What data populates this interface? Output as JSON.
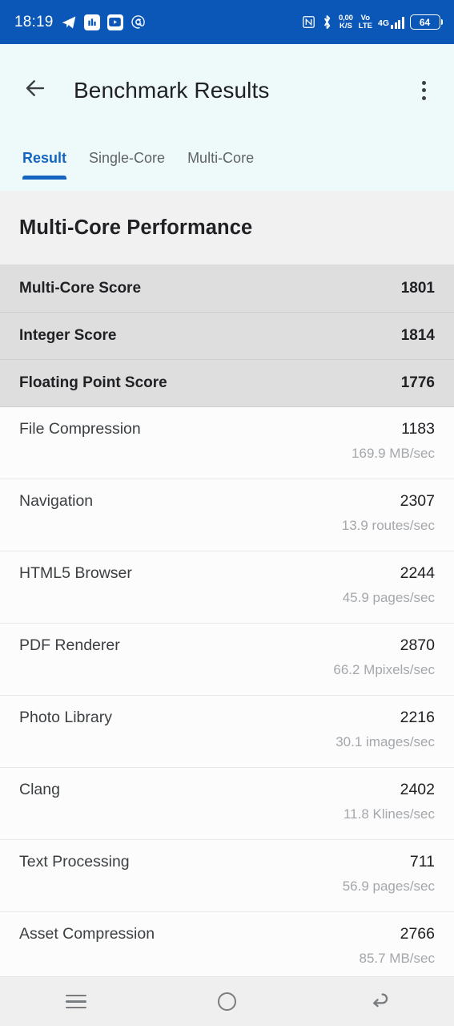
{
  "status_bar": {
    "time": "18:19",
    "left_icons": [
      "telegram-icon",
      "app-icon",
      "youtube-icon",
      "at-icon"
    ],
    "right_icons": [
      "nfc-icon",
      "bluetooth-icon"
    ],
    "data_rate_value": "0,00",
    "data_rate_unit": "K/S",
    "volte_top": "Vo",
    "volte_bottom": "LTE",
    "network_type": "4G",
    "battery_level": "64",
    "background_color": "#0b57b8"
  },
  "app_bar": {
    "back_label": "back-arrow",
    "title": "Benchmark Results",
    "overflow_label": "more-options",
    "background_color": "#eefaf9"
  },
  "tabs": {
    "accent_color": "#1565c0",
    "items": [
      {
        "label": "Result",
        "active": true
      },
      {
        "label": "Single-Core",
        "active": false
      },
      {
        "label": "Multi-Core",
        "active": false
      }
    ]
  },
  "section": {
    "heading": "Multi-Core Performance"
  },
  "summary_rows": [
    {
      "label": "Multi-Core Score",
      "value": "1801"
    },
    {
      "label": "Integer Score",
      "value": "1814"
    },
    {
      "label": "Floating Point Score",
      "value": "1776"
    }
  ],
  "detail_rows": [
    {
      "name": "File Compression",
      "score": "1183",
      "rate": "169.9 MB/sec"
    },
    {
      "name": "Navigation",
      "score": "2307",
      "rate": "13.9 routes/sec"
    },
    {
      "name": "HTML5 Browser",
      "score": "2244",
      "rate": "45.9 pages/sec"
    },
    {
      "name": "PDF Renderer",
      "score": "2870",
      "rate": "66.2 Mpixels/sec"
    },
    {
      "name": "Photo Library",
      "score": "2216",
      "rate": "30.1 images/sec"
    },
    {
      "name": "Clang",
      "score": "2402",
      "rate": "11.8 Klines/sec"
    },
    {
      "name": "Text Processing",
      "score": "711",
      "rate": "56.9 pages/sec"
    },
    {
      "name": "Asset Compression",
      "score": "2766",
      "rate": "85.7 MB/sec"
    }
  ],
  "nav_bar": {
    "recents_label": "recents",
    "home_label": "home",
    "back_label": "back"
  }
}
